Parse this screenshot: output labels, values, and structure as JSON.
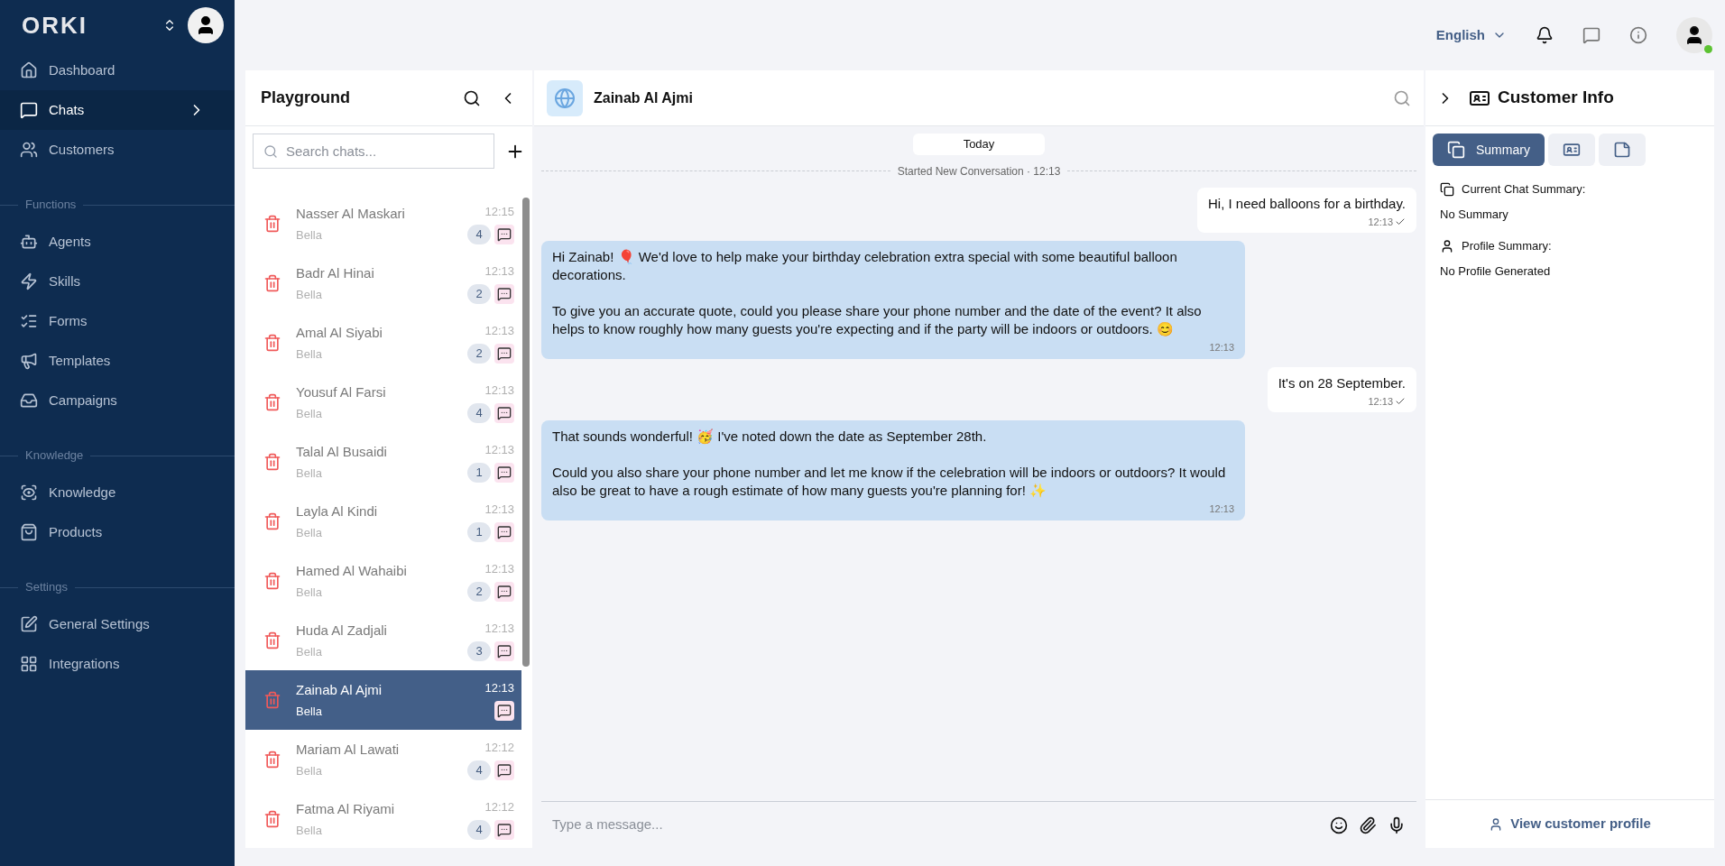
{
  "sidebar": {
    "logo": "ORKI",
    "groups": [
      {
        "items": [
          {
            "label": "Dashboard",
            "selected": false,
            "expandable": false
          },
          {
            "label": "Chats",
            "selected": true,
            "expandable": true
          },
          {
            "label": "Customers",
            "selected": false,
            "expandable": false
          }
        ]
      },
      {
        "heading": "Functions",
        "items": [
          {
            "label": "Agents",
            "selected": false,
            "expandable": false
          },
          {
            "label": "Skills",
            "selected": false,
            "expandable": false
          },
          {
            "label": "Forms",
            "selected": false,
            "expandable": false
          },
          {
            "label": "Templates",
            "selected": false,
            "expandable": false
          },
          {
            "label": "Campaigns",
            "selected": false,
            "expandable": false
          }
        ]
      },
      {
        "heading": "Knowledge",
        "items": [
          {
            "label": "Knowledge",
            "selected": false,
            "expandable": false
          },
          {
            "label": "Products",
            "selected": false,
            "expandable": false
          }
        ]
      },
      {
        "heading": "Settings",
        "items": [
          {
            "label": "General Settings",
            "selected": false,
            "expandable": false
          },
          {
            "label": "Integrations",
            "selected": false,
            "expandable": false
          }
        ]
      }
    ]
  },
  "top_bar": {
    "language": "English",
    "online": true
  },
  "chat_list": {
    "title": "Playground",
    "search": {
      "placeholder": "Search chats..."
    },
    "rows": [
      {
        "name": "Nasser Al Maskari",
        "agent": "Bella",
        "time": "12:15",
        "count": "4",
        "selected": false
      },
      {
        "name": "Badr Al Hinai",
        "agent": "Bella",
        "time": "12:13",
        "count": "2",
        "selected": false
      },
      {
        "name": "Amal Al Siyabi",
        "agent": "Bella",
        "time": "12:13",
        "count": "2",
        "selected": false
      },
      {
        "name": "Yousuf Al Farsi",
        "agent": "Bella",
        "time": "12:13",
        "count": "4",
        "selected": false
      },
      {
        "name": "Talal Al Busaidi",
        "agent": "Bella",
        "time": "12:13",
        "count": "1",
        "selected": false
      },
      {
        "name": "Layla Al Kindi",
        "agent": "Bella",
        "time": "12:13",
        "count": "1",
        "selected": false
      },
      {
        "name": "Hamed Al Wahaibi",
        "agent": "Bella",
        "time": "12:13",
        "count": "2",
        "selected": false
      },
      {
        "name": "Huda Al Zadjali",
        "agent": "Bella",
        "time": "12:13",
        "count": "3",
        "selected": false
      },
      {
        "name": "Zainab Al Ajmi",
        "agent": "Bella",
        "time": "12:13",
        "selected": true
      },
      {
        "name": "Mariam Al Lawati",
        "agent": "Bella",
        "time": "12:12",
        "count": "4",
        "selected": false
      },
      {
        "name": "Fatma Al Riyami",
        "agent": "Bella",
        "time": "12:12",
        "count": "4",
        "selected": false
      }
    ]
  },
  "conversation": {
    "contact": "Zainab Al Ajmi",
    "date": "Today",
    "divider": "Started New Conversation · 12:13",
    "messages": [
      {
        "kind": "customer",
        "paragraphs": [
          "Hi, I need balloons for a birthday."
        ],
        "time": "12:13",
        "read": true
      },
      {
        "kind": "agent",
        "paragraphs": [
          "Hi Zainab! 🎈 We'd love to help make your birthday celebration extra special with some beautiful balloon decorations.",
          "To give you an accurate quote, could you please share your phone number and the date of the event? It also helps to know roughly how many guests you're expecting and if the party will be indoors or outdoors. 😊"
        ],
        "time": "12:13"
      },
      {
        "kind": "customer",
        "paragraphs": [
          "It's on 28 September."
        ],
        "time": "12:13",
        "read": true
      },
      {
        "kind": "agent",
        "paragraphs": [
          "That sounds wonderful! 🥳 I've noted down the date as September 28th.",
          "Could you also share your phone number and let me know if the celebration will be indoors or outdoors? It would also be great to have a rough estimate of how many guests you're planning for! ✨"
        ],
        "time": "12:13"
      }
    ],
    "composer": {
      "placeholder": "Type a message..."
    }
  },
  "customer_info": {
    "title": "Customer Info",
    "tabs": [
      {
        "kind": "summary",
        "label": "Summary",
        "selected": true
      },
      {
        "kind": "profile",
        "selected": false
      },
      {
        "kind": "notes",
        "selected": false
      }
    ],
    "sections": [
      {
        "kind": "chat",
        "heading": "Current Chat Summary:",
        "value": "No Summary"
      },
      {
        "kind": "profile",
        "heading": "Profile Summary:",
        "value": "No Profile Generated"
      }
    ],
    "link": "View customer profile"
  }
}
